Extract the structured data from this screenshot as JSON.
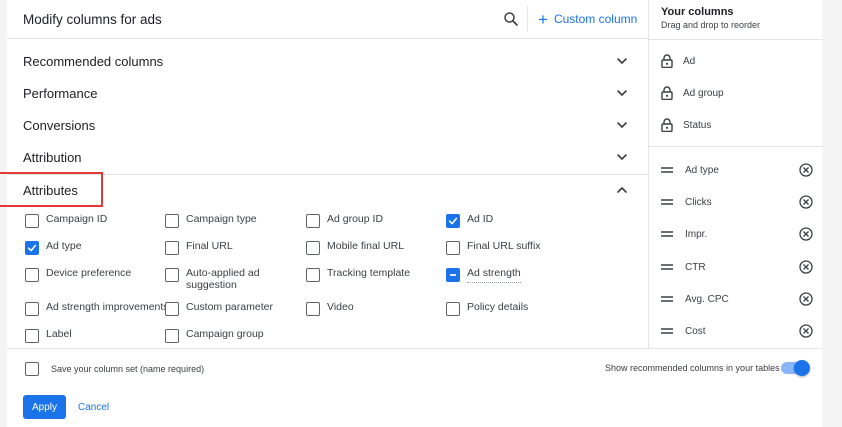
{
  "header": {
    "title": "Modify columns for ads",
    "custom_column_label": "Custom column"
  },
  "sections": [
    {
      "label": "Recommended columns",
      "expanded": false
    },
    {
      "label": "Performance",
      "expanded": false
    },
    {
      "label": "Conversions",
      "expanded": false
    },
    {
      "label": "Attribution",
      "expanded": false
    },
    {
      "label": "Attributes",
      "expanded": true
    }
  ],
  "attributes": {
    "rows": [
      [
        {
          "label": "Campaign ID",
          "state": "unchecked"
        },
        {
          "label": "Campaign type",
          "state": "unchecked"
        },
        {
          "label": "Ad group ID",
          "state": "unchecked"
        },
        {
          "label": "Ad ID",
          "state": "checked"
        }
      ],
      [
        {
          "label": "Ad type",
          "state": "checked"
        },
        {
          "label": "Final URL",
          "state": "unchecked"
        },
        {
          "label": "Mobile final URL",
          "state": "unchecked"
        },
        {
          "label": "Final URL suffix",
          "state": "unchecked"
        }
      ],
      [
        {
          "label": "Device preference",
          "state": "unchecked"
        },
        {
          "label": "Auto-applied ad suggestion",
          "state": "unchecked"
        },
        {
          "label": "Tracking template",
          "state": "unchecked"
        },
        {
          "label": "Ad strength",
          "state": "partial"
        }
      ],
      [
        {
          "label": "Ad strength improvements",
          "state": "unchecked"
        },
        {
          "label": "Custom parameter",
          "state": "unchecked"
        },
        {
          "label": "Video",
          "state": "unchecked"
        },
        {
          "label": "Policy details",
          "state": "unchecked"
        }
      ],
      [
        {
          "label": "Label",
          "state": "unchecked"
        },
        {
          "label": "Campaign group",
          "state": "unchecked"
        }
      ]
    ]
  },
  "your_columns": {
    "title": "Your columns",
    "subtitle": "Drag and drop to reorder",
    "locked": [
      "Ad",
      "Ad group",
      "Status"
    ],
    "movable": [
      "Ad type",
      "Clicks",
      "Impr.",
      "CTR",
      "Avg. CPC",
      "Cost"
    ]
  },
  "footer": {
    "save_label": "Save your column set (name required)",
    "recommended_label": "Show recommended columns in your tables",
    "recommended_on": true,
    "apply_label": "Apply",
    "cancel_label": "Cancel"
  },
  "colors": {
    "accent": "#1a73e8",
    "highlight": "#e53935"
  },
  "icons": [
    "search-icon",
    "plus-icon",
    "chevron-down-icon",
    "chevron-up-icon",
    "lock-icon",
    "drag-handle-icon",
    "remove-circle-icon",
    "checkbox"
  ]
}
